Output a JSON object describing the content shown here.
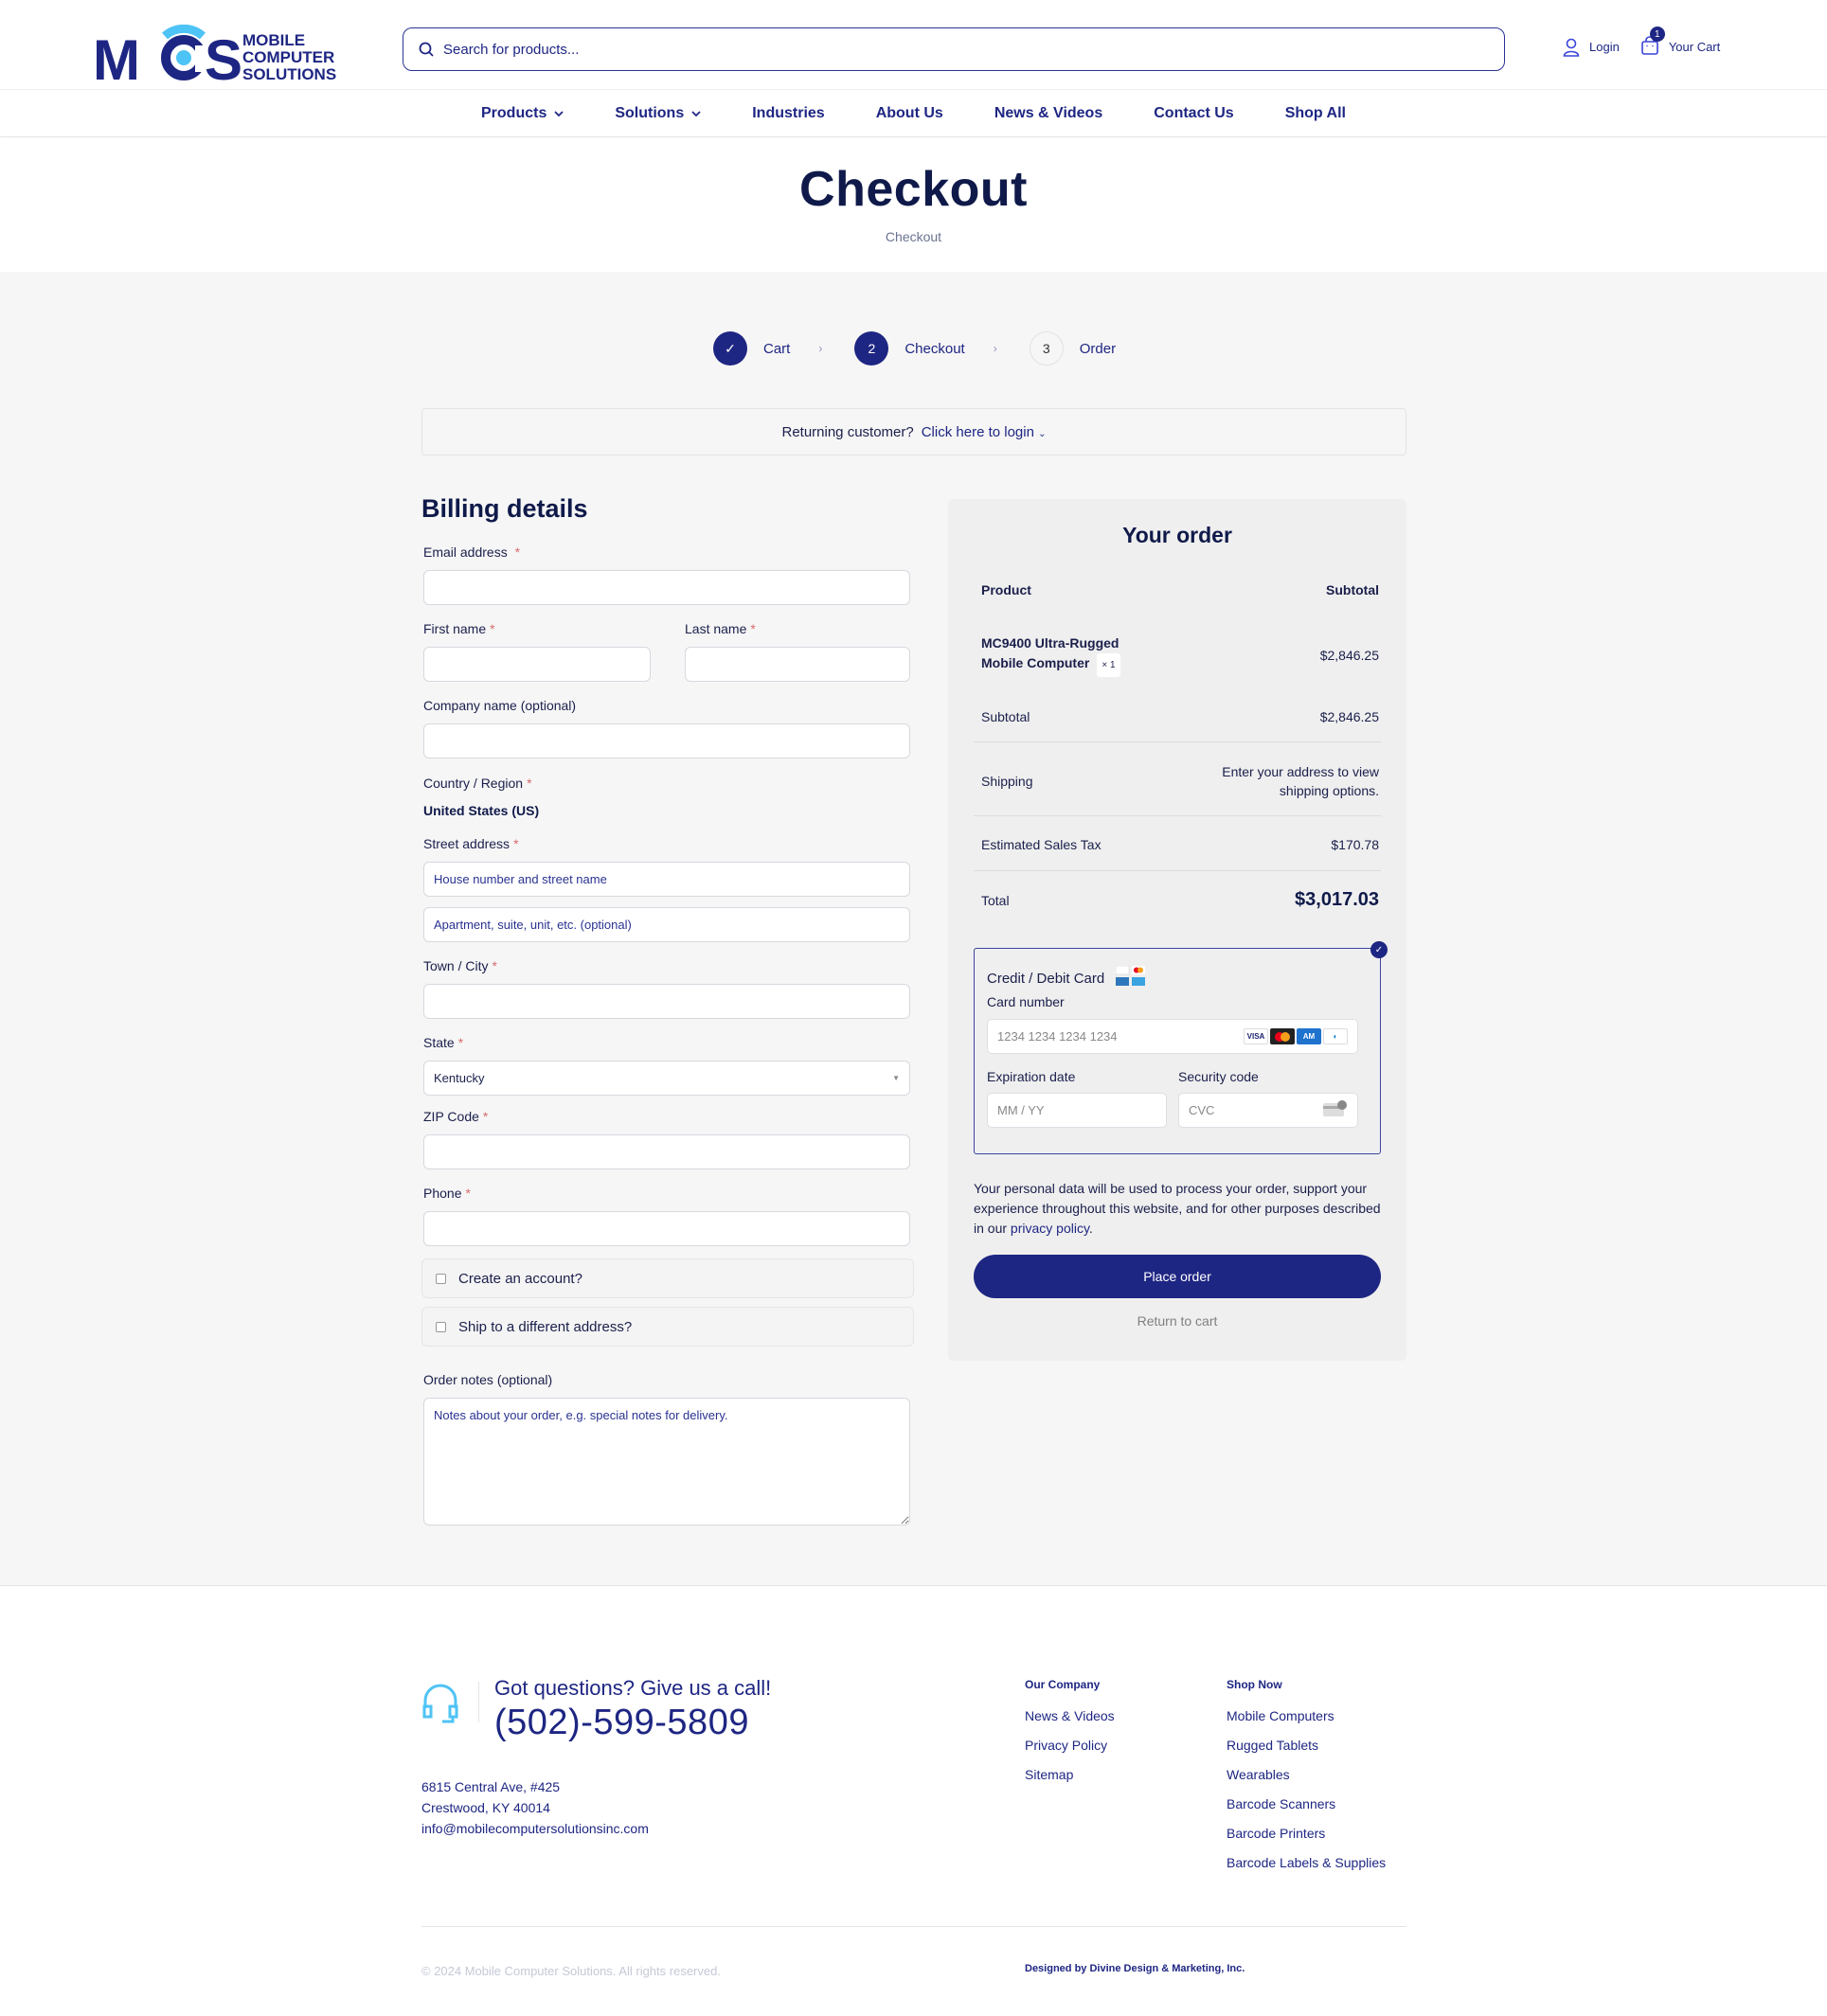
{
  "brand": {
    "logo_letters": "MCS",
    "logo_line1": "MOBILE",
    "logo_line2": "COMPUTER",
    "logo_line3": "SOLUTIONS",
    "colors": {
      "navy": "#1e2683",
      "light_blue": "#4ec3f5",
      "dark_text": "#0f1a4a",
      "required": "#d86b6b"
    }
  },
  "header": {
    "search_placeholder": "Search for products...",
    "login_label": "Login",
    "cart_label": "Your Cart",
    "cart_count": "1"
  },
  "nav": {
    "items": [
      {
        "label": "Products",
        "has_dropdown": true
      },
      {
        "label": "Solutions",
        "has_dropdown": true
      },
      {
        "label": "Industries",
        "has_dropdown": false
      },
      {
        "label": "About Us",
        "has_dropdown": false
      },
      {
        "label": "News & Videos",
        "has_dropdown": false
      },
      {
        "label": "Contact Us",
        "has_dropdown": false
      },
      {
        "label": "Shop All",
        "has_dropdown": false
      }
    ]
  },
  "page": {
    "title": "Checkout",
    "breadcrumb": "Checkout"
  },
  "steps": [
    {
      "number": "✓",
      "label": "Cart",
      "state": "done"
    },
    {
      "number": "2",
      "label": "Checkout",
      "state": "active"
    },
    {
      "number": "3",
      "label": "Order",
      "state": "todo"
    }
  ],
  "returning": {
    "text": "Returning customer?",
    "link": "Click here to login"
  },
  "billing": {
    "heading": "Billing details",
    "email_label": "Email address",
    "first_name_label": "First name",
    "last_name_label": "Last name",
    "company_label": "Company name (optional)",
    "country_label": "Country / Region",
    "country_value": "United States (US)",
    "street_label": "Street address",
    "street1_placeholder": "House number and street name",
    "street2_placeholder": "Apartment, suite, unit, etc. (optional)",
    "city_label": "Town / City",
    "state_label": "State",
    "state_value": "Kentucky",
    "zip_label": "ZIP Code",
    "phone_label": "Phone",
    "create_account_label": "Create an account?",
    "create_account_checked": false,
    "ship_different_label": "Ship to a different address?",
    "ship_different_checked": false,
    "notes_label": "Order notes (optional)",
    "notes_placeholder": "Notes about your order, e.g. special notes for delivery."
  },
  "order": {
    "heading": "Your order",
    "col_product": "Product",
    "col_subtotal": "Subtotal",
    "item_name_line1": "MC9400 Ultra-Rugged",
    "item_name_line2": "Mobile Computer",
    "item_qty": "× 1",
    "item_price": "$2,846.25",
    "subtotal_label": "Subtotal",
    "subtotal_value": "$2,846.25",
    "shipping_label": "Shipping",
    "shipping_value_line1": "Enter your address to view",
    "shipping_value_line2": "shipping options.",
    "tax_label": "Estimated Sales Tax",
    "tax_value": "$170.78",
    "total_label": "Total",
    "total_value": "$3,017.03"
  },
  "payment": {
    "method_label": "Credit / Debit Card",
    "card_number_label": "Card number",
    "card_number_placeholder": "1234 1234 1234 1234",
    "expiry_label": "Expiration date",
    "expiry_placeholder": "MM / YY",
    "cvc_label": "Security code",
    "cvc_placeholder": "CVC",
    "card_brands": [
      "VISA",
      "Mastercard",
      "AMEX",
      "Diners"
    ],
    "privacy_text": "Your personal data will be used to process your order, support your experience throughout this website, and for other purposes described in our ",
    "privacy_link": "privacy policy",
    "privacy_end": ".",
    "place_order": "Place order",
    "return_to_cart": "Return to cart"
  },
  "footer": {
    "call_question": "Got questions? Give us a call!",
    "phone": "(502)-599-5809",
    "address_line1": "6815 Central Ave, #425",
    "address_line2": "Crestwood, KY 40014",
    "email": "info@mobilecomputersolutionsinc.com",
    "company_heading": "Our Company",
    "company_links": [
      "News & Videos",
      "Privacy Policy",
      "Sitemap"
    ],
    "shop_heading": "Shop Now",
    "shop_links": [
      "Mobile Computers",
      "Rugged Tablets",
      "Wearables",
      "Barcode Scanners",
      "Barcode Printers",
      "Barcode Labels & Supplies"
    ],
    "copyright": "© 2024 Mobile Computer Solutions. All rights reserved.",
    "designed_by": "Designed by Divine Design & Marketing, Inc."
  }
}
